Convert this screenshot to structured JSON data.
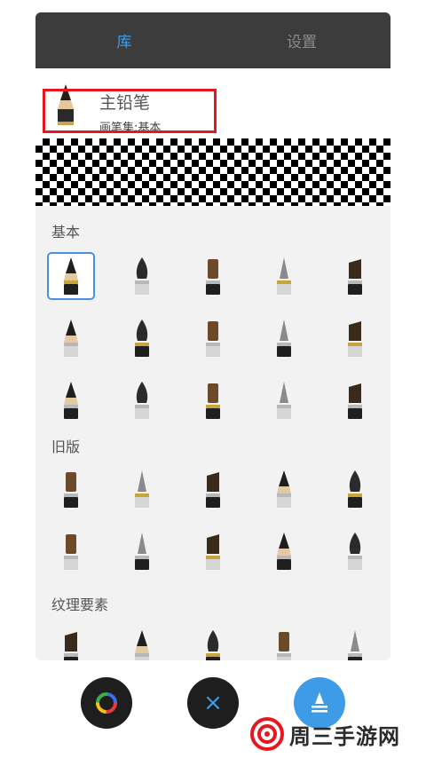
{
  "tabs": [
    {
      "label": "库",
      "active": true
    },
    {
      "label": "设置",
      "active": false
    }
  ],
  "current_brush": {
    "name": "主铅笔",
    "set": "画笔集:基本",
    "icon": "pencil-icon"
  },
  "sections": [
    {
      "title": "基本",
      "brushes": [
        "pencil-icon",
        "marker-icon",
        "ink-pen-icon",
        "ballpoint-icon",
        "fountain-pen-icon",
        "round-brush-icon",
        "ink-brush-icon",
        "airbrush-icon",
        "flat-marker-icon",
        "wide-marker-icon",
        "eraser-soft-icon",
        "eraser-hard-icon",
        "bristle-brush-icon",
        "fan-brush-icon",
        "stiff-brush-icon"
      ]
    },
    {
      "title": "旧版",
      "brushes": [
        "legacy-pencil-icon",
        "legacy-airbrush-icon",
        "legacy-marker-icon",
        "legacy-chisel-icon",
        "legacy-ballpoint-icon",
        "legacy-paintbrush-icon",
        "legacy-fine-brush-icon",
        "legacy-nib-icon",
        "legacy-eraser-icon",
        "legacy-smudge-icon"
      ]
    },
    {
      "title": "纹理要素",
      "brushes": [
        "texture-pencil-icon",
        "texture-crayon-icon",
        "texture-block-icon",
        "texture-bristle-icon",
        "texture-stamp-icon"
      ]
    }
  ],
  "bottom_bar": {
    "color_button": "color-wheel-icon",
    "close_button": "×",
    "brush_button": "brush-icon"
  },
  "watermark": {
    "text": "周三手游网"
  },
  "colors": {
    "accent": "#3d9be8",
    "highlight": "#e8161f",
    "tabbar": "#3c3c3c"
  }
}
